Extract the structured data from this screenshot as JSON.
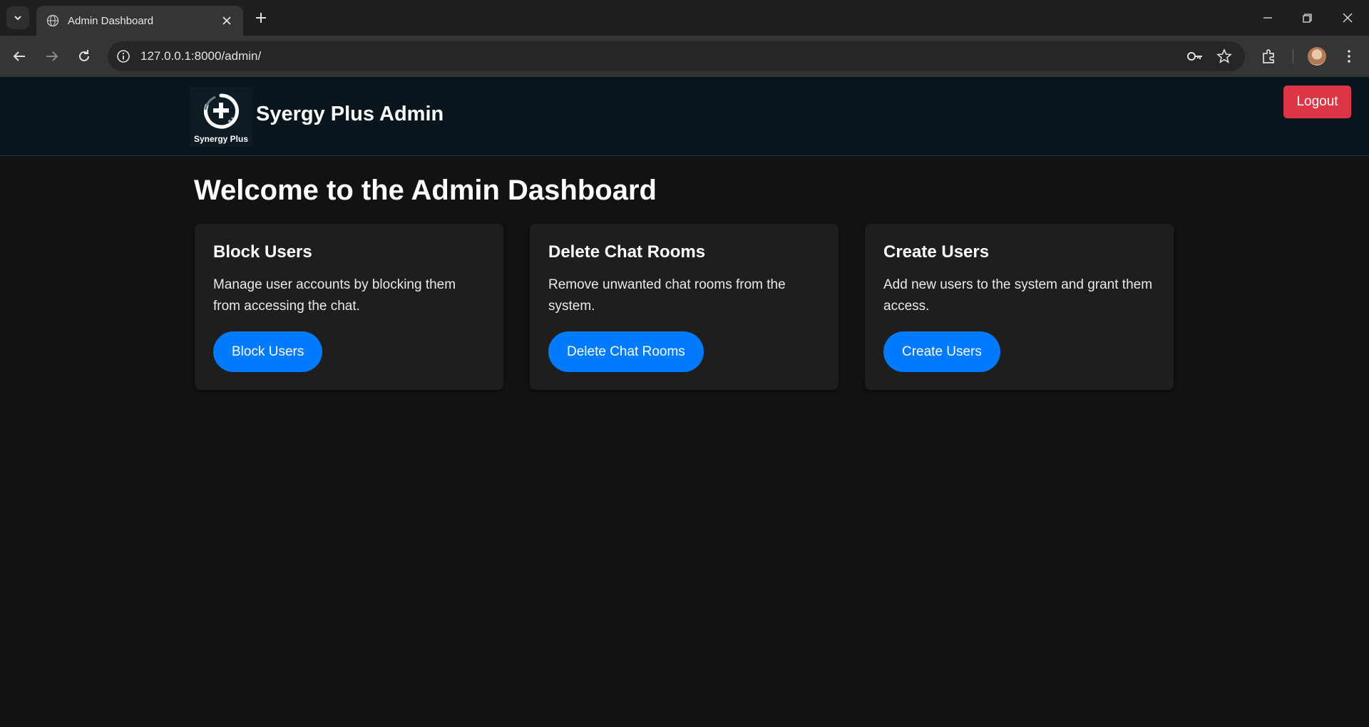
{
  "browser": {
    "tab_title": "Admin Dashboard",
    "url": "127.0.0.1:8000/admin/"
  },
  "header": {
    "logo_text": "Synergy Plus",
    "brand": "Syergy Plus Admin",
    "logout_label": "Logout"
  },
  "main": {
    "title": "Welcome to the Admin Dashboard",
    "cards": [
      {
        "heading": "Block Users",
        "description": "Manage user accounts by blocking them from accessing the chat.",
        "button": "Block Users"
      },
      {
        "heading": "Delete Chat Rooms",
        "description": "Remove unwanted chat rooms from the system.",
        "button": "Delete Chat Rooms"
      },
      {
        "heading": "Create Users",
        "description": "Add new users to the system and grant them access.",
        "button": "Create Users"
      }
    ]
  },
  "colors": {
    "logout": "#dc3545",
    "primary_button": "#007bff",
    "header_bg": "#08151d",
    "page_bg": "#121212",
    "card_bg": "#1e1e1e"
  },
  "icons": [
    "chevron-down-icon",
    "globe-icon",
    "close-icon",
    "plus-icon",
    "minimize-icon",
    "restore-icon",
    "window-close-icon",
    "back-icon",
    "forward-icon",
    "reload-icon",
    "info-icon",
    "key-icon",
    "star-icon",
    "extensions-icon",
    "kebab-menu-icon"
  ]
}
